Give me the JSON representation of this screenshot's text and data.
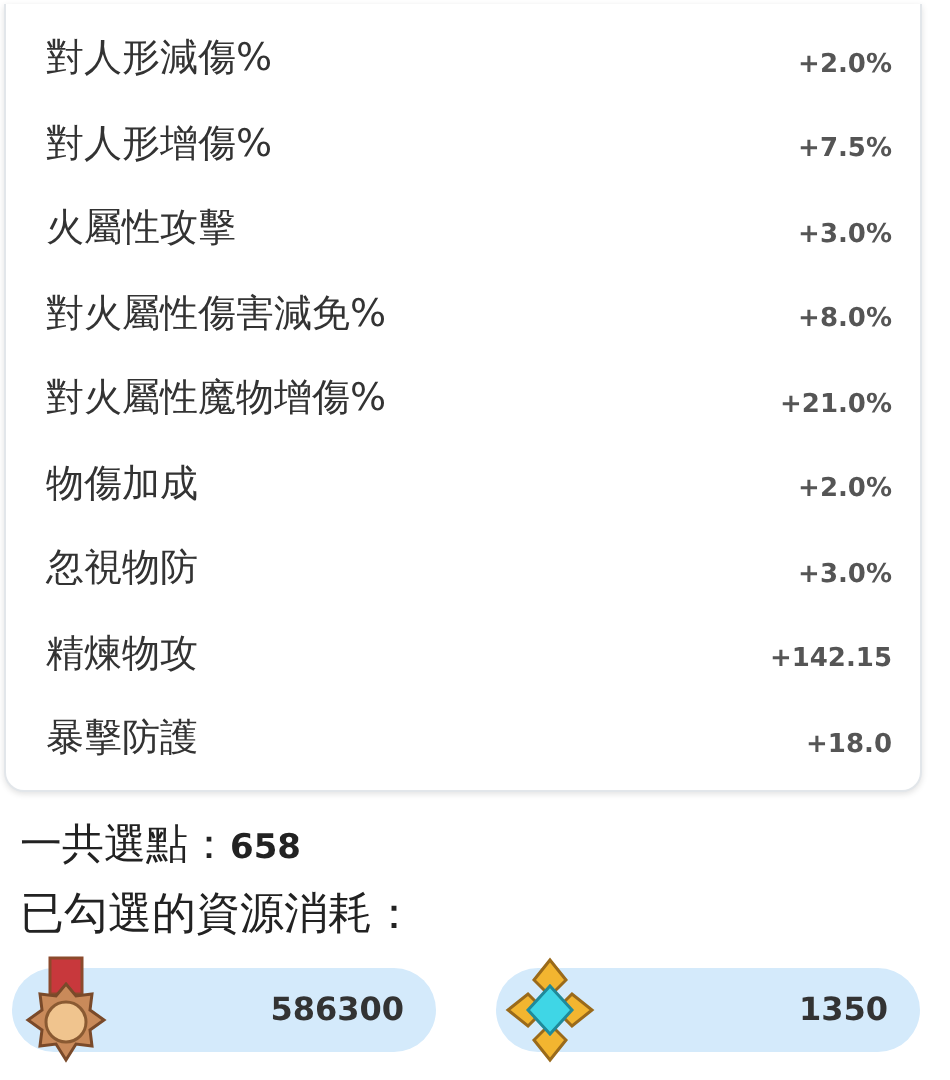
{
  "stats": [
    {
      "label": "對人形減傷%",
      "value": "+2.0%"
    },
    {
      "label": "對人形增傷%",
      "value": "+7.5%"
    },
    {
      "label": "火屬性攻擊",
      "value": "+3.0%"
    },
    {
      "label": "對火屬性傷害減免%",
      "value": "+8.0%"
    },
    {
      "label": "對火屬性魔物增傷%",
      "value": "+21.0%"
    },
    {
      "label": "物傷加成",
      "value": "+2.0%"
    },
    {
      "label": "忽視物防",
      "value": "+3.0%"
    },
    {
      "label": "精煉物攻",
      "value": "+142.15"
    },
    {
      "label": "暴擊防護",
      "value": "+18.0"
    }
  ],
  "total": {
    "label": "一共選點：",
    "value": "658"
  },
  "cost_title": "已勾選的資源消耗：",
  "resources": [
    {
      "kind": "medal",
      "amount": "586300"
    },
    {
      "kind": "crystal",
      "amount": "1350"
    }
  ]
}
